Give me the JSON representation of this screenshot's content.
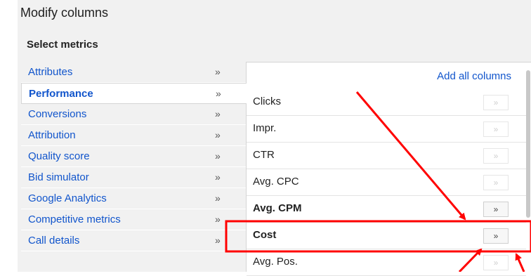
{
  "dialog": {
    "title": "Modify columns",
    "subtitle": "Select metrics"
  },
  "categories": [
    {
      "label": "Attributes",
      "chevron": "»"
    },
    {
      "label": "Performance",
      "chevron": "»"
    },
    {
      "label": "Conversions",
      "chevron": "»"
    },
    {
      "label": "Attribution",
      "chevron": "»"
    },
    {
      "label": "Quality score",
      "chevron": "»"
    },
    {
      "label": "Bid simulator",
      "chevron": "»"
    },
    {
      "label": "Google Analytics",
      "chevron": "»"
    },
    {
      "label": "Competitive metrics",
      "chevron": "»"
    },
    {
      "label": "Call details",
      "chevron": "»"
    }
  ],
  "metrics": {
    "add_all_label": "Add all columns",
    "items": [
      {
        "label": "Clicks",
        "button": "»"
      },
      {
        "label": "Impr.",
        "button": "»"
      },
      {
        "label": "CTR",
        "button": "»"
      },
      {
        "label": "Avg. CPC",
        "button": "»"
      },
      {
        "label": "Avg. CPM",
        "button": "»"
      },
      {
        "label": "Cost",
        "button": "»"
      },
      {
        "label": "Avg. Pos.",
        "button": "»"
      }
    ]
  },
  "colors": {
    "link": "#1155cc",
    "annotation": "#ff0000"
  }
}
